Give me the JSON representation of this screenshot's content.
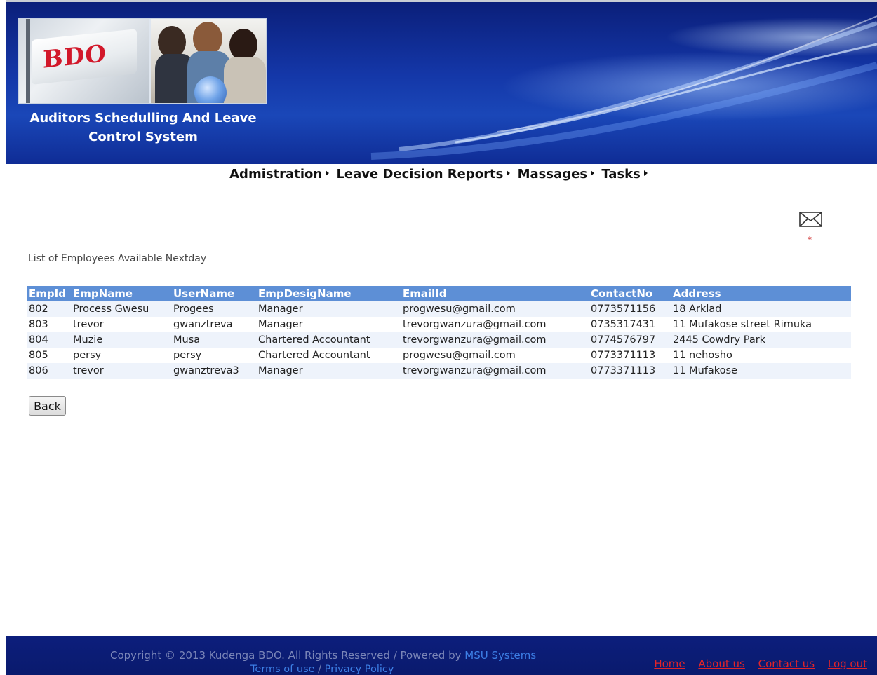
{
  "header": {
    "logo_text": "BDO",
    "system_title_line1": "Auditors Schedulling And Leave",
    "system_title_line2": "Control System"
  },
  "nav": {
    "items": [
      {
        "label": "Admistration"
      },
      {
        "label": "Leave Decision Reports"
      },
      {
        "label": "Massages"
      },
      {
        "label": "Tasks"
      }
    ]
  },
  "mail": {
    "icon": "envelope-icon",
    "marker": "*"
  },
  "main": {
    "title": "List of Employees Available Nextday",
    "table": {
      "headers": [
        "EmpId",
        "EmpName",
        "UserName",
        "EmpDesigName",
        "EmailId",
        "ContactNo",
        "Address"
      ],
      "rows": [
        [
          "802",
          "Process Gwesu",
          "Progees",
          "Manager",
          "progwesu@gmail.com",
          "0773571156",
          "18 Arklad"
        ],
        [
          "803",
          "trevor",
          "gwanztreva",
          "Manager",
          "trevorgwanzura@gmail.com",
          "0735317431",
          "11 Mufakose street Rimuka"
        ],
        [
          "804",
          "Muzie",
          "Musa",
          "Chartered Accountant",
          "trevorgwanzura@gmail.com",
          "0774576797",
          "2445 Cowdry Park"
        ],
        [
          "805",
          "persy",
          "persy",
          "Chartered Accountant",
          "progwesu@gmail.com",
          "0773371113",
          "11 nehosho"
        ],
        [
          "806",
          "trevor",
          "gwanztreva3",
          "Manager",
          "trevorgwanzura@gmail.com",
          "0773371113",
          "11 Mufakose"
        ]
      ]
    },
    "back_label": "Back"
  },
  "footer": {
    "copyright_text": "Copyright © 2013 Kudenga BDO. All Rights Reserved / Powered by ",
    "powered_link": "MSU Systems",
    "terms_link": "Terms of use",
    "terms_sep": " / ",
    "privacy_link": "Privacy Policy",
    "links": [
      "Home",
      "About us",
      "Contact us",
      "Log out"
    ]
  },
  "colors": {
    "banner": "#1437a8",
    "table_header": "#5d8fd6",
    "footer": "#0c1e7c",
    "footer_link": "#e0242a"
  }
}
